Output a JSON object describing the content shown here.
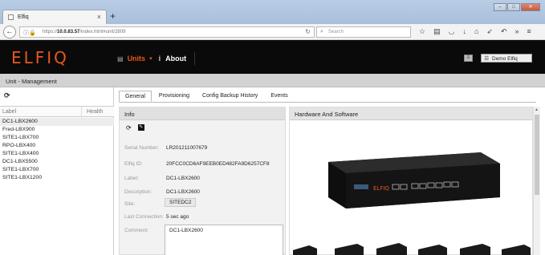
{
  "browser": {
    "tab_title": "Elfiq",
    "url_prefix": "https://",
    "url_host": "10.0.83.57",
    "url_path": "/index.html#unit/2809",
    "search_placeholder": "Search"
  },
  "app": {
    "logo": "ELFIQ",
    "menu": {
      "units": "Units",
      "info_icon": "i",
      "about": "About"
    },
    "user": "Demo Elfiq"
  },
  "page_title": "Unit - Management",
  "units_list": {
    "headers": {
      "label": "Label",
      "health": "Health"
    },
    "rows": [
      "DC1-LBX2600",
      "Fred-LBX900",
      "SITE1-LBX700",
      "RPO-LBX400",
      "SITE1-LBX400",
      "DC1-LBX5500",
      "SITE1-LBX700",
      "SITE1-LBX1200"
    ],
    "selected_index": 0
  },
  "tabs": [
    "General",
    "Provisioning",
    "Config Backup History",
    "Events"
  ],
  "info": {
    "title": "Info",
    "fields": {
      "serial_label": "Serial Number:",
      "serial": "LR201211007679",
      "elfiq_id_label": "Elfiq ID:",
      "elfiq_id": "20FCC0CD6AF9EEB0ED482FA9D6257CF8",
      "label_label": "Label:",
      "label": "DC1-LBX2600",
      "description_label": "Description:",
      "description": "DC1-LBX2600",
      "site_label": "Site:",
      "site": "SITEDC2",
      "last_conn_label": "Last Connection:",
      "last_conn": "5 sec ago",
      "comment_label": "Comment:",
      "comment": "DC1-LBX2600"
    }
  },
  "hardware": {
    "title": "Hardware And Software",
    "device_brand": "ELFIQ"
  },
  "colors": {
    "accent": "#e8581c",
    "header_bg": "#0a0a0a"
  }
}
